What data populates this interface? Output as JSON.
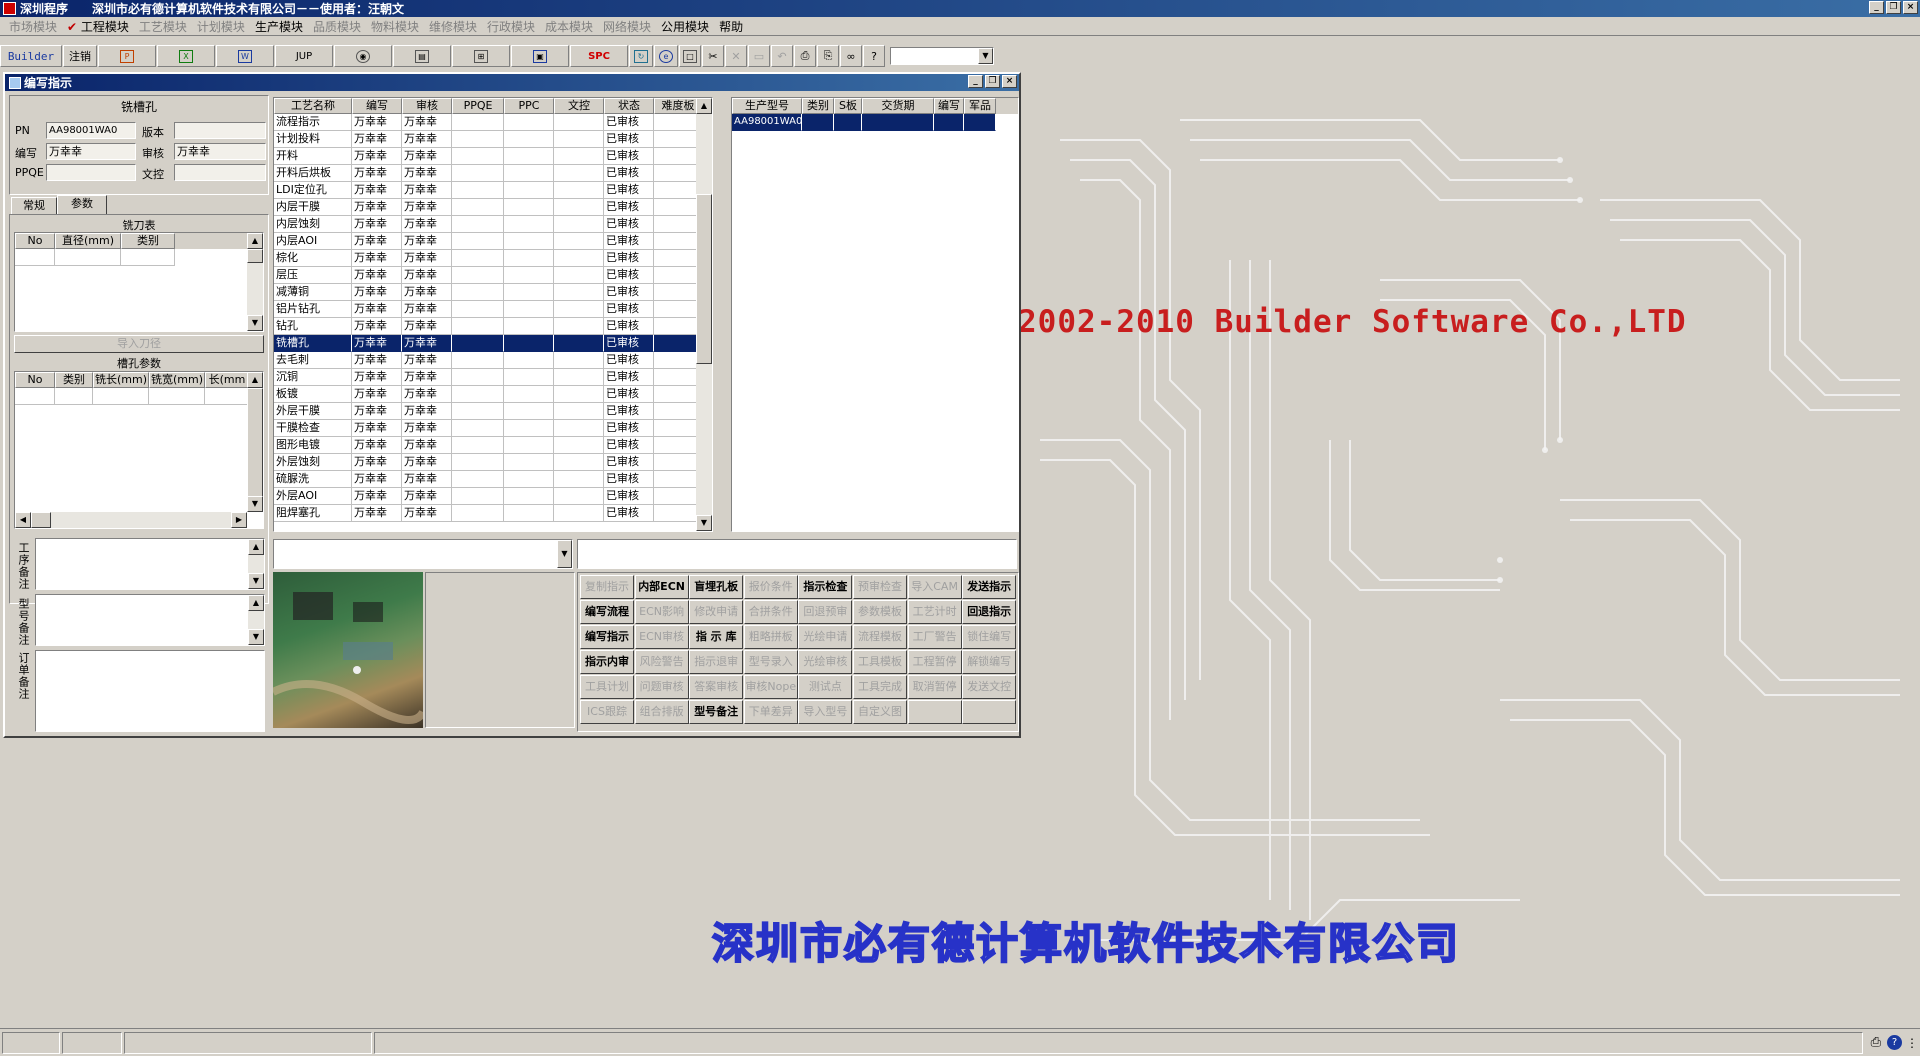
{
  "app": {
    "title": "深圳程序",
    "caption": "深圳市必有德计算机软件技术有限公司－－使用者：汪朝文"
  },
  "menu": [
    {
      "label": "市场模块",
      "enabled": false
    },
    {
      "label": "工程模块",
      "enabled": true,
      "checked": true
    },
    {
      "label": "工艺模块",
      "enabled": false
    },
    {
      "label": "计划模块",
      "enabled": false
    },
    {
      "label": "生产模块",
      "enabled": true
    },
    {
      "label": "品质模块",
      "enabled": false
    },
    {
      "label": "物料模块",
      "enabled": false
    },
    {
      "label": "维修模块",
      "enabled": false
    },
    {
      "label": "行政模块",
      "enabled": false
    },
    {
      "label": "成本模块",
      "enabled": false
    },
    {
      "label": "网络模块",
      "enabled": false
    },
    {
      "label": "公用模块",
      "enabled": true
    },
    {
      "label": "帮助",
      "enabled": true
    }
  ],
  "toolbar": {
    "builder": "Builder",
    "logout": "注销",
    "jup": "JUP",
    "spc": "SPC",
    "combo_value": ""
  },
  "background": {
    "copyright": "2002-2010 Builder Software Co.,LTD",
    "company": "深圳市必有德计算机软件技术有限公司"
  },
  "window": {
    "title": "编写指示"
  },
  "left": {
    "header": "铣槽孔",
    "pn_label": "PN",
    "pn_value": "AA98001WA0",
    "version_label": "版本",
    "version_value": "",
    "writer_label": "编写",
    "writer_value": "万幸幸",
    "reviewer_label": "审核",
    "reviewer_value": "万幸幸",
    "ppqe_label": "PPQE",
    "ppqe_value": "",
    "doc_label": "文控",
    "doc_value": "",
    "tabs": [
      "常规",
      "参数"
    ],
    "cutter_title": "铣刀表",
    "cutter_columns": [
      "No",
      "直径(mm)",
      "类别"
    ],
    "import_button": "导入刀径",
    "slot_title": "槽孔参数",
    "slot_columns": [
      "No",
      "类别",
      "铣长(mm)",
      "铣宽(mm)",
      "长(mm"
    ],
    "notes": [
      "工序备注",
      "型号备注",
      "订单备注"
    ]
  },
  "process": {
    "columns": [
      "工艺名称",
      "编写",
      "审核",
      "PPQE",
      "PPC",
      "文控",
      "状态",
      "难度板"
    ],
    "rows": [
      {
        "name": "流程指示",
        "writer": "万幸幸",
        "reviewer": "万幸幸",
        "status": "已审核"
      },
      {
        "name": "计划投料",
        "writer": "万幸幸",
        "reviewer": "万幸幸",
        "status": "已审核"
      },
      {
        "name": "开料",
        "writer": "万幸幸",
        "reviewer": "万幸幸",
        "status": "已审核"
      },
      {
        "name": "开料后烘板",
        "writer": "万幸幸",
        "reviewer": "万幸幸",
        "status": "已审核"
      },
      {
        "name": "LDI定位孔",
        "writer": "万幸幸",
        "reviewer": "万幸幸",
        "status": "已审核"
      },
      {
        "name": "内层干膜",
        "writer": "万幸幸",
        "reviewer": "万幸幸",
        "status": "已审核"
      },
      {
        "name": "内层蚀刻",
        "writer": "万幸幸",
        "reviewer": "万幸幸",
        "status": "已审核"
      },
      {
        "name": "内层AOI",
        "writer": "万幸幸",
        "reviewer": "万幸幸",
        "status": "已审核"
      },
      {
        "name": "棕化",
        "writer": "万幸幸",
        "reviewer": "万幸幸",
        "status": "已审核"
      },
      {
        "name": "层压",
        "writer": "万幸幸",
        "reviewer": "万幸幸",
        "status": "已审核"
      },
      {
        "name": "减薄铜",
        "writer": "万幸幸",
        "reviewer": "万幸幸",
        "status": "已审核"
      },
      {
        "name": "铝片钻孔",
        "writer": "万幸幸",
        "reviewer": "万幸幸",
        "status": "已审核"
      },
      {
        "name": "钻孔",
        "writer": "万幸幸",
        "reviewer": "万幸幸",
        "status": "已审核"
      },
      {
        "name": "铣槽孔",
        "writer": "万幸幸",
        "reviewer": "万幸幸",
        "status": "已审核",
        "selected": true
      },
      {
        "name": "去毛刺",
        "writer": "万幸幸",
        "reviewer": "万幸幸",
        "status": "已审核"
      },
      {
        "name": "沉铜",
        "writer": "万幸幸",
        "reviewer": "万幸幸",
        "status": "已审核"
      },
      {
        "name": "板镀",
        "writer": "万幸幸",
        "reviewer": "万幸幸",
        "status": "已审核"
      },
      {
        "name": "外层干膜",
        "writer": "万幸幸",
        "reviewer": "万幸幸",
        "status": "已审核"
      },
      {
        "name": "干膜检查",
        "writer": "万幸幸",
        "reviewer": "万幸幸",
        "status": "已审核"
      },
      {
        "name": "图形电镀",
        "writer": "万幸幸",
        "reviewer": "万幸幸",
        "status": "已审核"
      },
      {
        "name": "外层蚀刻",
        "writer": "万幸幸",
        "reviewer": "万幸幸",
        "status": "已审核"
      },
      {
        "name": "硫脲洗",
        "writer": "万幸幸",
        "reviewer": "万幸幸",
        "status": "已审核"
      },
      {
        "name": "外层AOI",
        "writer": "万幸幸",
        "reviewer": "万幸幸",
        "status": "已审核"
      },
      {
        "name": "阻焊塞孔",
        "writer": "万幸幸",
        "reviewer": "万幸幸",
        "status": "已审核"
      }
    ]
  },
  "product": {
    "columns": [
      "生产型号",
      "类别",
      "S板",
      "交货期",
      "编写",
      "军品"
    ],
    "rows": [
      {
        "model": "AA98001WA0"
      }
    ]
  },
  "buttons": [
    {
      "label": "复制指示",
      "enabled": false
    },
    {
      "label": "内部ECN",
      "enabled": true
    },
    {
      "label": "盲埋孔板",
      "enabled": true
    },
    {
      "label": "报价条件",
      "enabled": false
    },
    {
      "label": "指示检查",
      "enabled": true
    },
    {
      "label": "预审检查",
      "enabled": false
    },
    {
      "label": "导入CAM",
      "enabled": false
    },
    {
      "label": "发送指示",
      "enabled": true
    },
    {
      "label": "编写流程",
      "enabled": true
    },
    {
      "label": "ECN影响",
      "enabled": false
    },
    {
      "label": "修改申请",
      "enabled": false
    },
    {
      "label": "合拼条件",
      "enabled": false
    },
    {
      "label": "回退预审",
      "enabled": false
    },
    {
      "label": "参数模板",
      "enabled": false
    },
    {
      "label": "工艺计时",
      "enabled": false
    },
    {
      "label": "回退指示",
      "enabled": true
    },
    {
      "label": "编写指示",
      "enabled": true
    },
    {
      "label": "ECN审核",
      "enabled": false
    },
    {
      "label": "指 示 库",
      "enabled": true
    },
    {
      "label": "粗略拼板",
      "enabled": false
    },
    {
      "label": "光绘申请",
      "enabled": false
    },
    {
      "label": "流程模板",
      "enabled": false
    },
    {
      "label": "工厂警告",
      "enabled": false
    },
    {
      "label": "锁住编写",
      "enabled": false
    },
    {
      "label": "指示内审",
      "enabled": true
    },
    {
      "label": "风险警告",
      "enabled": false
    },
    {
      "label": "指示退审",
      "enabled": false
    },
    {
      "label": "型号录入",
      "enabled": false
    },
    {
      "label": "光绘审核",
      "enabled": false
    },
    {
      "label": "工具模板",
      "enabled": false
    },
    {
      "label": "工程暂停",
      "enabled": false
    },
    {
      "label": "解锁编写",
      "enabled": false
    },
    {
      "label": "工具计划",
      "enabled": false
    },
    {
      "label": "问题审核",
      "enabled": false
    },
    {
      "label": "答案审核",
      "enabled": false
    },
    {
      "label": "审核Nope",
      "enabled": false
    },
    {
      "label": "测试点",
      "enabled": false
    },
    {
      "label": "工具完成",
      "enabled": false
    },
    {
      "label": "取消暂停",
      "enabled": false
    },
    {
      "label": "发送文控",
      "enabled": false
    },
    {
      "label": "ICS跟踪",
      "enabled": false
    },
    {
      "label": "组合排版",
      "enabled": false
    },
    {
      "label": "型号备注",
      "enabled": true
    },
    {
      "label": "下单差异",
      "enabled": false
    },
    {
      "label": "导入型号",
      "enabled": false
    },
    {
      "label": "自定义图",
      "enabled": false
    },
    {
      "label": "",
      "enabled": false
    },
    {
      "label": "",
      "enabled": false
    }
  ],
  "inputs": {
    "dropdown_value": "",
    "text_value": ""
  }
}
